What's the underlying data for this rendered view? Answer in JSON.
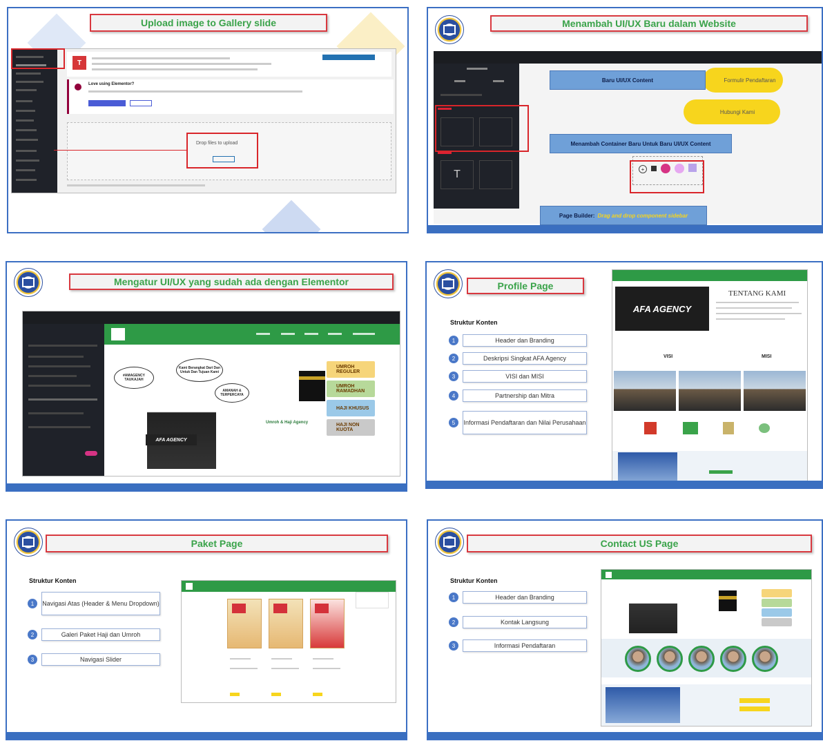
{
  "slides": [
    {
      "title": "Upload image to Gallery slide",
      "drop_text": "Drop files to upload",
      "ui": {
        "alert_title": "Love using Elementor?"
      }
    },
    {
      "title": "Menambah UI/UX Baru dalam Website",
      "callouts": {
        "content": "Baru UI/UX Content",
        "container": "Menambah Container Baru Untuk Baru UI/UX Content",
        "builder_prefix": "Page Builder:",
        "builder_highlight": "Drag and drop component sidebar"
      },
      "buttons": {
        "pendaftaran": "Formulir Pendaftaran",
        "hubungi": "Hubungi Kami"
      }
    },
    {
      "title": "Mengatur UI/UX yang sudah ada dengan Elementor",
      "bubbles": {
        "b1": "#AMAGENCY TAUKAJAH",
        "b2": "Kami Berangkat Dari Dan Untuk Dan Tujuan Kami",
        "b3": "AMANAH & TERPERCAYA"
      },
      "brand": "Umroh & Haji Agency",
      "banner_text": "AFA AGENCY",
      "packages": [
        "UMROH REGULER",
        "UMROH RAMADHAN",
        "HAJI KHUSUS",
        "HAJI NON KUOTA"
      ]
    },
    {
      "title": "Profile Page",
      "label": "Struktur Konten",
      "steps": [
        "Header dan Branding",
        "Deskripsi Singkat AFA Agency",
        "VISI dan MISI",
        "Partnership dan Mitra",
        "Informasi Pendaftaran dan Nilai Perusahaan"
      ],
      "preview": {
        "heading": "TENTANG KAMI",
        "logo_text": "AFA AGENCY",
        "visi": "VISI",
        "misi": "MISI"
      }
    },
    {
      "title": "Paket Page",
      "label": "Struktur Konten",
      "steps": [
        "Navigasi Atas (Header & Menu Dropdown)",
        "Galeri Paket Haji dan Umroh",
        "Navigasi Slider"
      ]
    },
    {
      "title": "Contact US Page",
      "label": "Struktur Konten",
      "steps": [
        "Header dan Branding",
        "Kontak Langsung",
        "Informasi Pendaftaran"
      ]
    }
  ]
}
